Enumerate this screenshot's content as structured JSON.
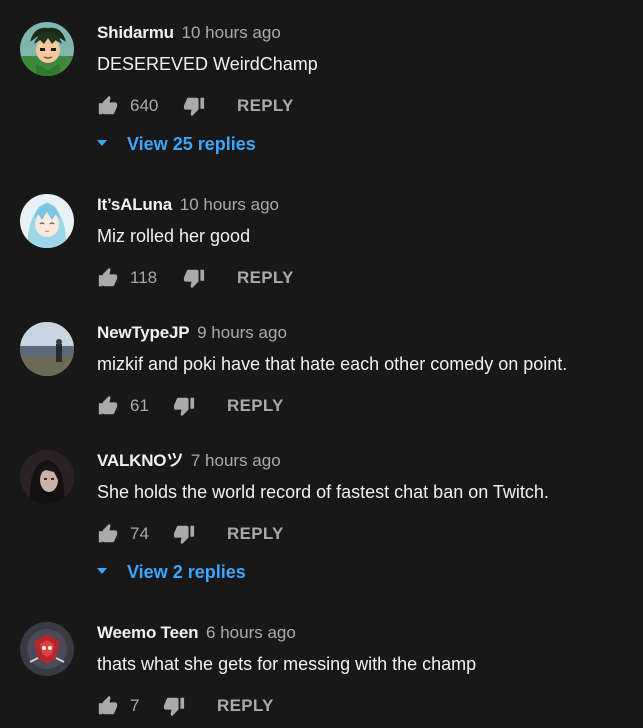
{
  "comments": [
    {
      "author": "Shidarmu",
      "time": "10 hours ago",
      "text": "DESEREVED WeirdChamp",
      "likes": "640",
      "reply_label": "REPLY",
      "view_replies": "View 25 replies",
      "avatar_icon": "anime-boy-green-avatar"
    },
    {
      "author": "It’sALuna",
      "time": "10 hours ago",
      "text": "Miz rolled her good",
      "likes": "118",
      "reply_label": "REPLY",
      "avatar_icon": "anime-girl-blue-hair-avatar"
    },
    {
      "author": "NewTypeJP",
      "time": "9 hours ago",
      "text": "mizkif and poki have that hate each other comedy on point.",
      "likes": "61",
      "reply_label": "REPLY",
      "avatar_icon": "landscape-photo-avatar"
    },
    {
      "author": "VALKNOツ",
      "time": "7 hours ago",
      "text": "She holds the world record of fastest chat ban on Twitch.",
      "likes": "74",
      "reply_label": "REPLY",
      "view_replies": "View 2 replies",
      "avatar_icon": "dark-portrait-avatar"
    },
    {
      "author": "Weemo Teen",
      "time": "6 hours ago",
      "text": "thats what she gets for messing with the champ",
      "likes": "7",
      "reply_label": "REPLY",
      "avatar_icon": "red-mech-avatar"
    }
  ],
  "colors": {
    "background": "#181818",
    "text_primary": "#f1f1f1",
    "text_secondary": "#aaaaaa",
    "link_blue": "#3ea6ff"
  }
}
